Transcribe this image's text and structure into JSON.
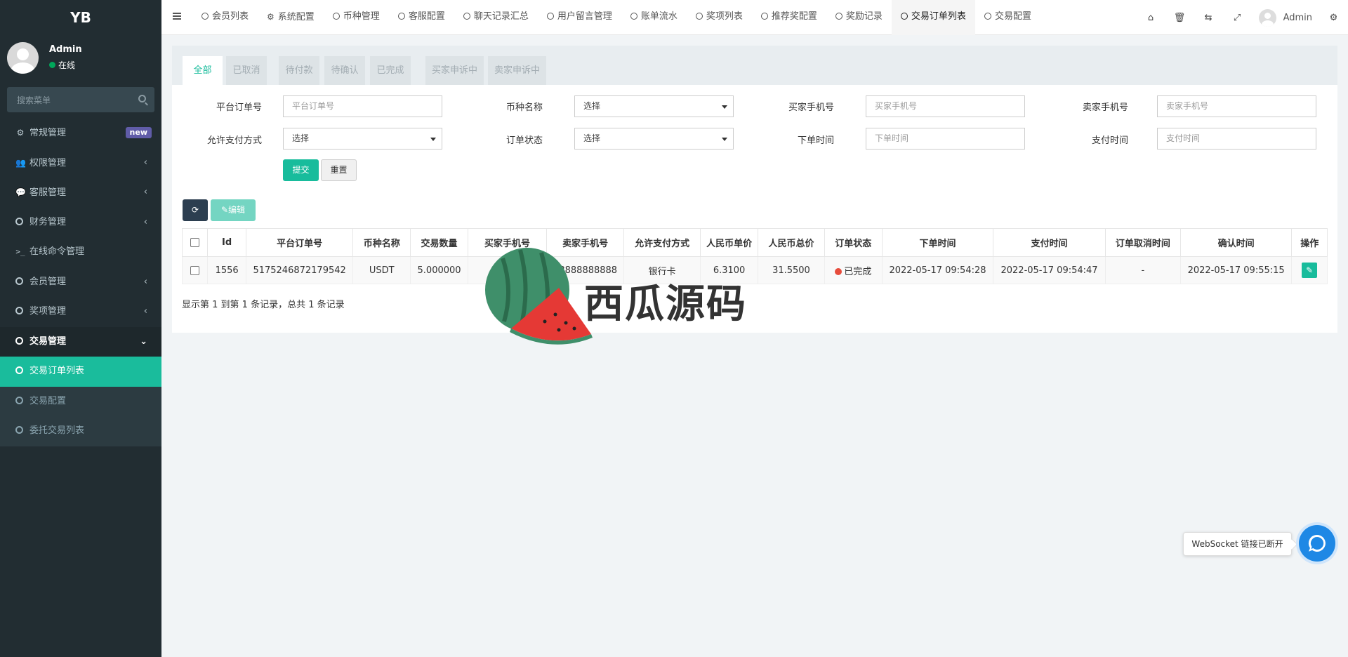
{
  "app": {
    "logo": "YB"
  },
  "user": {
    "name": "Admin",
    "status": "在线"
  },
  "sidebar": {
    "search_placeholder": "搜索菜单",
    "items": [
      {
        "label": "常规管理",
        "badge": "new",
        "icon": "cogs-icon"
      },
      {
        "label": "权限管理",
        "icon": "users-icon"
      },
      {
        "label": "客服管理",
        "icon": "comment-icon"
      },
      {
        "label": "财务管理",
        "icon": "circle-icon"
      },
      {
        "label": "在线命令管理",
        "icon": "terminal-icon"
      },
      {
        "label": "会员管理",
        "icon": "circle-icon"
      },
      {
        "label": "奖项管理",
        "icon": "circle-icon"
      },
      {
        "label": "交易管理",
        "icon": "circle-icon"
      }
    ],
    "subitems": [
      {
        "label": "交易订单列表"
      },
      {
        "label": "交易配置"
      },
      {
        "label": "委托交易列表"
      }
    ]
  },
  "topnav": {
    "tabs": [
      {
        "label": "会员列表"
      },
      {
        "label": "系统配置"
      },
      {
        "label": "币种管理"
      },
      {
        "label": "客服配置"
      },
      {
        "label": "聊天记录汇总"
      },
      {
        "label": "用户留言管理"
      },
      {
        "label": "账单流水"
      },
      {
        "label": "奖项列表"
      },
      {
        "label": "推荐奖配置"
      },
      {
        "label": "奖励记录"
      },
      {
        "label": "交易订单列表"
      },
      {
        "label": "交易配置"
      }
    ],
    "admin_name": "Admin"
  },
  "status_tabs": [
    "全部",
    "已取消",
    "待付款",
    "待确认",
    "已完成",
    "买家申诉中",
    "卖家申诉中"
  ],
  "filters": {
    "order_no": {
      "label": "平台订单号",
      "placeholder": "平台订单号"
    },
    "coin": {
      "label": "币种名称",
      "value": "选择"
    },
    "buyer_phone": {
      "label": "买家手机号",
      "placeholder": "买家手机号"
    },
    "seller_phone": {
      "label": "卖家手机号",
      "placeholder": "卖家手机号"
    },
    "pay_method": {
      "label": "允许支付方式",
      "value": "选择"
    },
    "order_status": {
      "label": "订单状态",
      "value": "选择"
    },
    "order_time": {
      "label": "下单时间",
      "placeholder": "下单时间"
    },
    "pay_time": {
      "label": "支付时间",
      "placeholder": "支付时间"
    },
    "submit": "提交",
    "reset": "重置"
  },
  "toolbar": {
    "edit": "编辑"
  },
  "table": {
    "headers": [
      "Id",
      "平台订单号",
      "币种名称",
      "交易数量",
      "买家手机号",
      "卖家手机号",
      "允许支付方式",
      "人民币单价",
      "人民币总价",
      "订单状态",
      "下单时间",
      "支付时间",
      "订单取消时间",
      "确认时间",
      "操作"
    ],
    "rows": [
      {
        "id": "1556",
        "order_no": "5175246872179542",
        "coin": "USDT",
        "amount": "5.000000",
        "buyer": "13",
        "seller": "18888888888",
        "pay_method": "银行卡",
        "unit_price": "6.3100",
        "total": "31.5500",
        "status": "已完成",
        "order_time": "2022-05-17 09:54:28",
        "pay_time": "2022-05-17 09:54:47",
        "cancel_time": "-",
        "confirm_time": "2022-05-17 09:55:15"
      }
    ]
  },
  "summary": "显示第 1 到第 1 条记录，总共 1 条记录",
  "watermark": {
    "text": "西瓜源码"
  },
  "toast": {
    "text": "WebSocket 链接已断开"
  },
  "colors": {
    "accent": "#18bc9c",
    "sidebar": "#222d32",
    "danger": "#e74c3c",
    "chat": "#1e88e5"
  }
}
